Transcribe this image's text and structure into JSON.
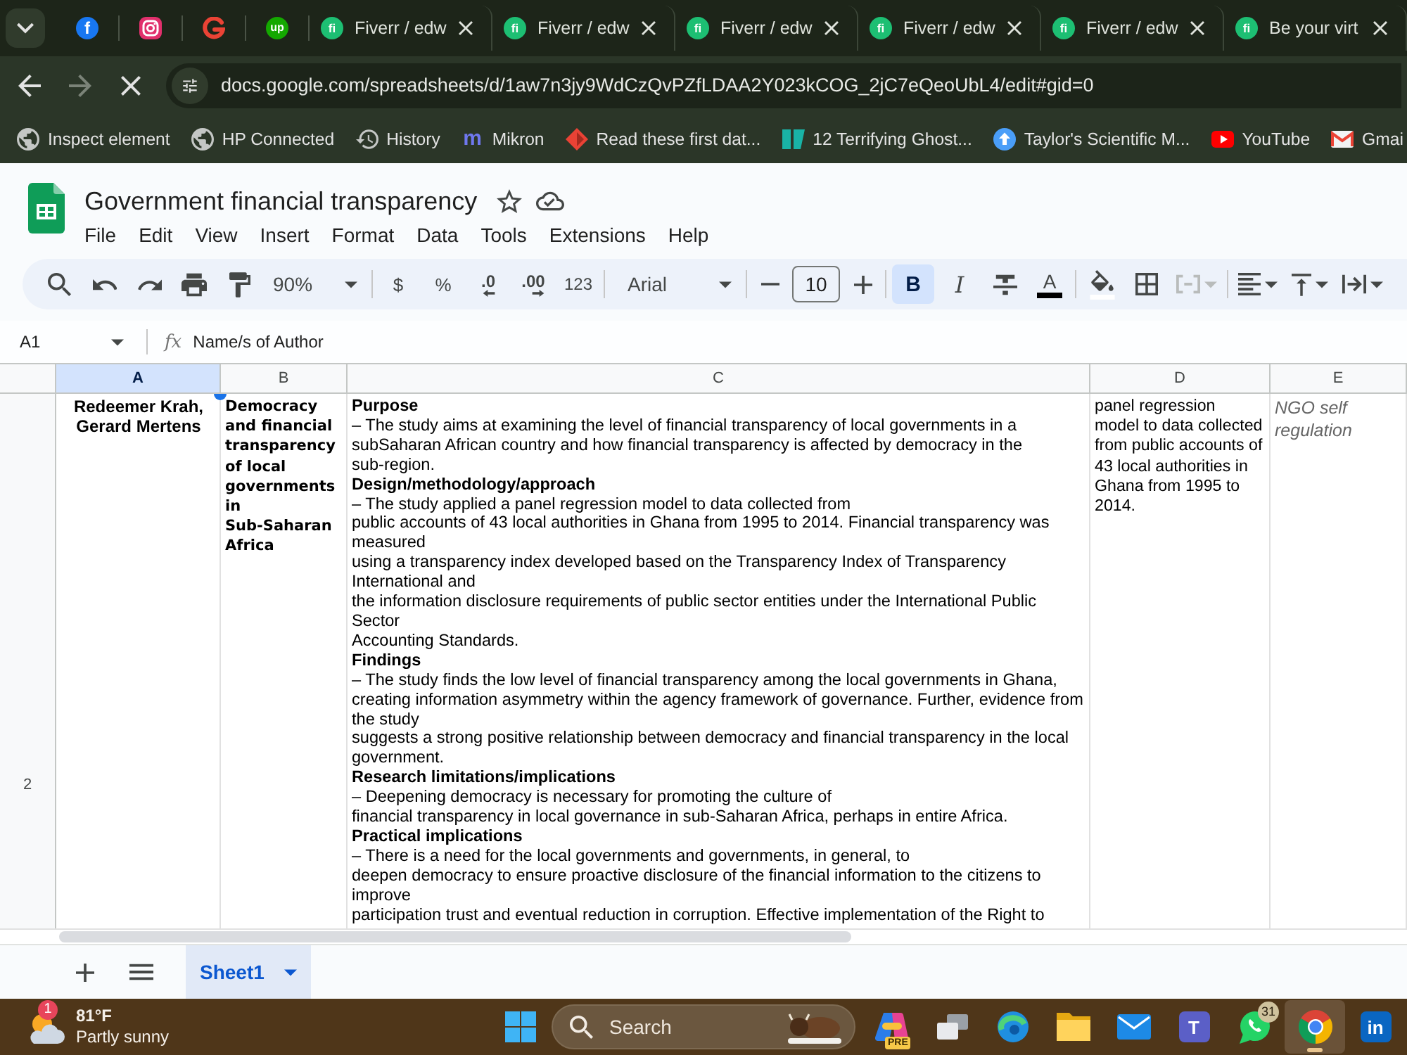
{
  "browser": {
    "pinned_tabs": [
      {
        "kind": "letter",
        "icon_text": "f",
        "color": "#1877f2"
      },
      {
        "kind": "camera"
      },
      {
        "kind": "swirl"
      },
      {
        "kind": "letter",
        "icon_text": "up",
        "color": "#14a800"
      }
    ],
    "tabs": [
      {
        "title": "Fiverr / edw",
        "icon_text": "fi",
        "selected": false
      },
      {
        "title": "Fiverr / edw",
        "icon_text": "fi",
        "selected": false
      },
      {
        "title": "Fiverr / edw",
        "icon_text": "fi",
        "selected": false
      },
      {
        "title": "Fiverr / edw",
        "icon_text": "fi",
        "selected": false
      },
      {
        "title": "Fiverr / edw",
        "icon_text": "fi",
        "selected": false
      },
      {
        "title": "Be your virt",
        "icon_text": "fi",
        "selected": false
      }
    ],
    "nav_buttons": [
      {
        "kind": "back",
        "disabled": false
      },
      {
        "kind": "forward",
        "disabled": true
      },
      {
        "kind": "stop",
        "disabled": false
      }
    ],
    "url": "docs.google.com/spreadsheets/d/1aw7n3jy9WdCzQvPZfLDAA2Y023kCOG_2jC7eQeoUbL4/edit#gid=0",
    "bookmarks": [
      {
        "kind": "globe",
        "label": "Inspect element"
      },
      {
        "kind": "globe",
        "label": "HP Connected"
      },
      {
        "kind": "history",
        "label": "History"
      },
      {
        "kind": "letter",
        "icon_text": "m",
        "label": "Mikron"
      },
      {
        "kind": "diamond",
        "label": "Read these first dat..."
      },
      {
        "kind": "bars",
        "label": "12 Terrifying Ghost..."
      },
      {
        "kind": "upload",
        "label": "Taylor's Scientific M..."
      },
      {
        "kind": "play",
        "label": "YouTube"
      },
      {
        "kind": "mail",
        "label": "Gmai"
      }
    ]
  },
  "sheets": {
    "title": "Government financial transparency",
    "menu": [
      "File",
      "Edit",
      "View",
      "Insert",
      "Format",
      "Data",
      "Tools",
      "Extensions",
      "Help"
    ],
    "toolbar": [
      {
        "kind": "search",
        "on": false,
        "disabled": false
      },
      {
        "kind": "undo",
        "on": false,
        "disabled": false
      },
      {
        "kind": "redo",
        "on": false,
        "disabled": false
      },
      {
        "kind": "print",
        "on": false,
        "disabled": false
      },
      {
        "kind": "paint-format",
        "on": false,
        "disabled": false
      },
      {
        "kind": "zoom",
        "text": "90%",
        "on": false,
        "disabled": false
      },
      {
        "kind": "separator"
      },
      {
        "kind": "currency",
        "text": "$",
        "on": false,
        "disabled": false
      },
      {
        "kind": "percent",
        "text": "%",
        "on": false,
        "disabled": false
      },
      {
        "kind": "decimal-decrease",
        "text": ".0",
        "on": false,
        "disabled": false
      },
      {
        "kind": "decimal-increase",
        "text": ".00",
        "on": false,
        "disabled": false
      },
      {
        "kind": "number-format",
        "text": "123",
        "on": false,
        "disabled": false
      },
      {
        "kind": "separator"
      },
      {
        "kind": "font",
        "text": "Arial",
        "on": false,
        "disabled": false
      },
      {
        "kind": "separator"
      },
      {
        "kind": "size-down",
        "on": false,
        "disabled": false
      },
      {
        "kind": "font-size",
        "text": "10",
        "on": false,
        "disabled": false
      },
      {
        "kind": "size-up",
        "on": false,
        "disabled": false
      },
      {
        "kind": "separator"
      },
      {
        "kind": "bold",
        "text": "B",
        "on": true,
        "disabled": false
      },
      {
        "kind": "italic",
        "text": "I",
        "on": false,
        "disabled": false
      },
      {
        "kind": "strikethrough",
        "on": false,
        "disabled": false
      },
      {
        "kind": "text-color",
        "text": "A",
        "on": false,
        "disabled": false
      },
      {
        "kind": "separator"
      },
      {
        "kind": "fill-color",
        "on": false,
        "disabled": false
      },
      {
        "kind": "borders",
        "on": false,
        "disabled": false
      },
      {
        "kind": "merge",
        "on": false,
        "disabled": true
      },
      {
        "kind": "separator"
      },
      {
        "kind": "align",
        "on": false,
        "disabled": false
      },
      {
        "kind": "vertical-align",
        "on": false,
        "disabled": false
      },
      {
        "kind": "wrap",
        "on": false,
        "disabled": false
      }
    ],
    "formula_bar": {
      "name_box": "A1",
      "function_label": "fx",
      "value": "Name/s of Author"
    },
    "columns": [
      {
        "label": "A",
        "selected": true
      },
      {
        "label": "B",
        "selected": false
      },
      {
        "label": "C",
        "selected": false
      },
      {
        "label": "D",
        "selected": false
      },
      {
        "label": "E",
        "selected": false
      }
    ],
    "rows": [
      {
        "number": "2",
        "cells": [
          {
            "kind": "centered",
            "text": "Redeemer Krah,\nGerard Mertens"
          },
          {
            "kind": "display",
            "text": "Democracy\nand financial\ntransparency\nof local\ngovernments\nin\nSub-Saharan\nAfrica"
          },
          {
            "kind": "rich",
            "text": "**Purpose**\n– The study aims at examining the level of financial transparency of local governments in a\nsubSaharan African country and how financial transparency is affected by democracy in the\nsub-region.\n**Design/methodology/approach**\n– The study applied a panel regression model to data collected from\npublic accounts of 43 local authorities in Ghana from 1995 to 2014. Financial transparency was\nmeasured\nusing a transparency index developed based on the Transparency Index of Transparency\nInternational and\nthe information disclosure requirements of public sector entities under the International Public\nSector\nAccounting Standards.\n**Findings**\n– The study finds the low level of financial transparency among the local governments in Ghana,\ncreating information asymmetry within the agency framework of governance. Further, evidence from\nthe study\nsuggests a strong positive relationship between democracy and financial transparency in the local\ngovernment.\n**Research limitations/implications**\n– Deepening democracy is necessary for promoting the culture of\nfinancial transparency in local governance in sub-Saharan Africa, perhaps in entire Africa.\n**Practical implications**\n– There is a need for the local governments and governments, in general, to\ndeepen democracy to ensure proactive disclosure of the financial information to the citizens to\nimprove\nparticipation trust and eventual reduction in corruption. Effective implementation of the Right to"
          },
          {
            "kind": "plain",
            "text": "panel regression\nmodel to data collected\nfrom public accounts of\n43 local authorities in\nGhana from 1995 to\n2014."
          },
          {
            "kind": "muted",
            "text": "NGO self regulation"
          }
        ]
      }
    ],
    "sheet_tabs": [
      {
        "label": "Sheet1",
        "selected": true
      }
    ]
  },
  "taskbar": {
    "weather": {
      "badge": "1",
      "temperature": "81°F",
      "condition": "Partly sunny"
    },
    "search": {
      "placeholder": "Search"
    },
    "apps": [
      {
        "kind": "copilot",
        "badge": "PRE",
        "active": false
      },
      {
        "kind": "task-view",
        "active": false
      },
      {
        "kind": "edge",
        "active": false
      },
      {
        "kind": "explorer",
        "active": false
      },
      {
        "kind": "mail",
        "active": false
      },
      {
        "kind": "teams",
        "icon_text": "T",
        "active": false
      },
      {
        "kind": "whatsapp",
        "badge": "31",
        "active": false
      },
      {
        "kind": "chrome",
        "active": true
      },
      {
        "kind": "linkedin",
        "icon_text": "in",
        "active": false
      }
    ]
  }
}
